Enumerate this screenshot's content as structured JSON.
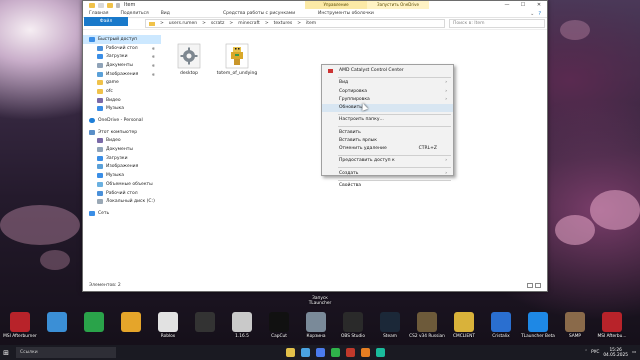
{
  "explorer": {
    "title": "Item",
    "context_tabs": [
      "Управление",
      "Запустить OneDrive"
    ],
    "window_controls": [
      "—",
      "☐",
      "✕"
    ],
    "ribbon_tabs": [
      "Файл",
      "Главная",
      "Поделиться",
      "Вид"
    ],
    "context_subtabs": [
      "Средства работы с рисунками",
      "Инструменты оболочки"
    ],
    "address_parts": [
      ">",
      "users.rumen",
      ">",
      "scratz",
      ">",
      "minecraft",
      ">",
      "textures",
      ">",
      "item"
    ],
    "search_placeholder": "Поиск в: Item",
    "nav": {
      "quick_access": "Быстрый доступ",
      "quick_items": [
        "Рабочий стол",
        "Загрузки",
        "Документы",
        "Изображения",
        "game",
        "оfc",
        "Видео",
        "Музыка"
      ],
      "onedrive": "OneDrive - Personal",
      "this_pc": "Этот компьютер",
      "pc_items": [
        "Видео",
        "Документы",
        "Загрузки",
        "Изображения",
        "Музыка",
        "Объемные объекты",
        "Рабочий стол",
        "Локальный диск (C:)"
      ],
      "network": "Сеть"
    },
    "files": [
      {
        "name": "desktop"
      },
      {
        "name": "totem_of_undying"
      }
    ],
    "status": "Элементов: 2"
  },
  "context_menu": {
    "items": [
      {
        "label": "AMD Catalyst Control Center"
      },
      {
        "label": "Вид",
        "submenu": true
      },
      {
        "label": "Сортировка",
        "submenu": true
      },
      {
        "label": "Группировка",
        "submenu": true
      },
      {
        "label": "Обновить"
      },
      {
        "label": "Настроить папку..."
      },
      {
        "label": "Вставить"
      },
      {
        "label": "Вставить ярлык"
      },
      {
        "label": "Отменить удаление",
        "shortcut": "CTRL+Z"
      },
      {
        "label": "Предоставить доступ к",
        "submenu": true
      },
      {
        "label": "Создать",
        "submenu": true
      },
      {
        "label": "Свойства"
      }
    ]
  },
  "desktop_icons": [
    {
      "label": "MSI Afterburner",
      "color": "#b8232a"
    },
    {
      "label": "",
      "color": "#3b8fd6"
    },
    {
      "label": "",
      "color": "#2aa34a"
    },
    {
      "label": "",
      "color": "#e5a52a"
    },
    {
      "label": "Roblox",
      "color": "#e2e2e2"
    },
    {
      "label": "",
      "color": "#333333"
    },
    {
      "label": "1.16.5",
      "color": "#c9c9c9"
    },
    {
      "label": "CapCut",
      "color": "#111111"
    },
    {
      "label": "Корзина",
      "color": "#7a8a99"
    },
    {
      "label": "OBS Studio",
      "color": "#2a2a2a"
    },
    {
      "label": "Steam",
      "color": "#1b2838"
    },
    {
      "label": "CS2 v34 Russian",
      "color": "#6d5a3a"
    },
    {
      "label": "CMCLIENT",
      "color": "#d9b23a"
    },
    {
      "label": "Cristalix",
      "color": "#2a6fd0"
    },
    {
      "label": "TLauncher Beta",
      "color": "#1e88e5"
    },
    {
      "label": "SAMP",
      "color": "#8a6a4a"
    },
    {
      "label": "MSI Afterbu...",
      "color": "#b8232a"
    }
  ],
  "upper_desktop_icon": {
    "label": "Запуск TLauncher"
  },
  "taskbar": {
    "search_text": "Ссылки",
    "apps_colors": [
      "#e2c04a",
      "#4aa3e2",
      "#4b7bec",
      "#2fb34a",
      "#c0392b",
      "#e67e22",
      "#1abc9c"
    ],
    "lang": "РУС",
    "time": "15:26",
    "date": "04.05.2025"
  }
}
